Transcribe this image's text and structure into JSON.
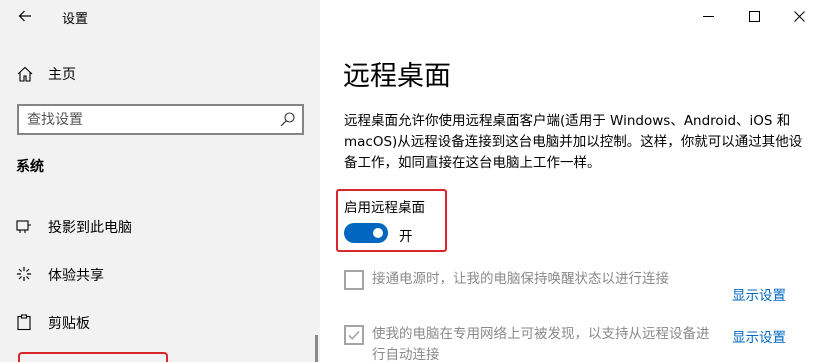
{
  "app_title": "设置",
  "sidebar": {
    "home_label": "主页",
    "search_placeholder": "查找设置",
    "section_label": "系统",
    "items": [
      {
        "label": "投影到此电脑",
        "icon": "projector-icon"
      },
      {
        "label": "体验共享",
        "icon": "share-experience-icon"
      },
      {
        "label": "剪贴板",
        "icon": "clipboard-icon"
      }
    ]
  },
  "window_controls": [
    "minimize-icon",
    "maximize-icon",
    "close-icon"
  ],
  "main": {
    "title": "远程桌面",
    "description": "远程桌面允许你使用远程桌面客户端(适用于 Windows、Android、iOS 和 macOS)从远程设备连接到这台电脑并加以控制。这样，你就可以通过其他设备工作，如同直接在这台电脑上工作一样。",
    "toggle": {
      "label": "启用远程桌面",
      "state_text": "开",
      "on": true
    },
    "options": [
      {
        "text": "接通电源时，让我的电脑保持唤醒状态以进行连接",
        "checked": false,
        "link": "显示设置"
      },
      {
        "text": "使我的电脑在专用网络上可被发现，以支持从远程设备进行自动连接",
        "checked": true,
        "link": "显示设置"
      }
    ]
  },
  "colors": {
    "accent": "#0067c0",
    "highlight": "#d9252c",
    "sidebar_bg": "#f2f2f2"
  }
}
